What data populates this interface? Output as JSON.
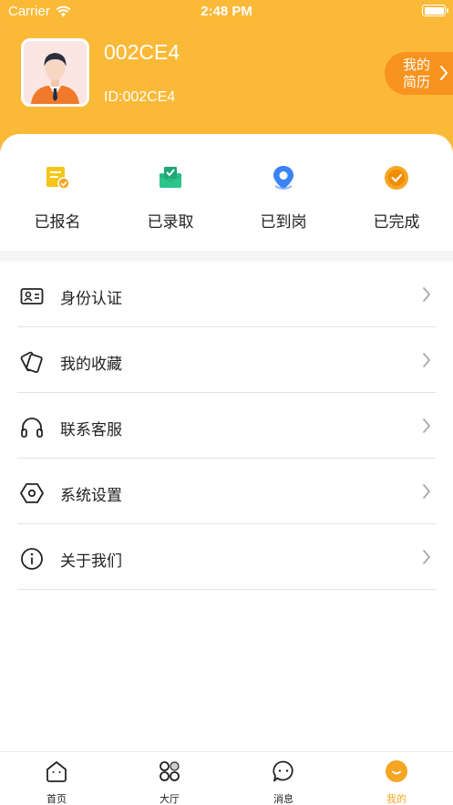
{
  "status_bar": {
    "carrier": "Carrier",
    "time": "2:48 PM"
  },
  "profile": {
    "name": "002CE4",
    "id_text": "ID:002CE4",
    "resume_label": "我的简历"
  },
  "status_items": [
    {
      "label": "已报名",
      "icon": "signed-up-icon",
      "color": "#f5c518"
    },
    {
      "label": "已录取",
      "icon": "admitted-icon",
      "color": "#2bc48a"
    },
    {
      "label": "已到岗",
      "icon": "location-pin-icon",
      "color": "#3b82f6"
    },
    {
      "label": "已完成",
      "icon": "completed-check-icon",
      "color": "#f5a623"
    }
  ],
  "menu": [
    {
      "label": "身份认证",
      "icon": "id-card-icon"
    },
    {
      "label": "我的收藏",
      "icon": "favorites-icon"
    },
    {
      "label": "联系客服",
      "icon": "headset-icon"
    },
    {
      "label": "系统设置",
      "icon": "settings-hexagon-icon"
    },
    {
      "label": "关于我们",
      "icon": "info-icon"
    }
  ],
  "tabs": [
    {
      "label": "首页",
      "icon": "home-icon",
      "active": false
    },
    {
      "label": "大厅",
      "icon": "hall-grid-icon",
      "active": false
    },
    {
      "label": "消息",
      "icon": "message-icon",
      "active": false
    },
    {
      "label": "我的",
      "icon": "profile-smile-icon",
      "active": true
    }
  ],
  "colors": {
    "header": "#fbb938",
    "resume_button": "#f7931e",
    "active_tab": "#f5a623"
  }
}
